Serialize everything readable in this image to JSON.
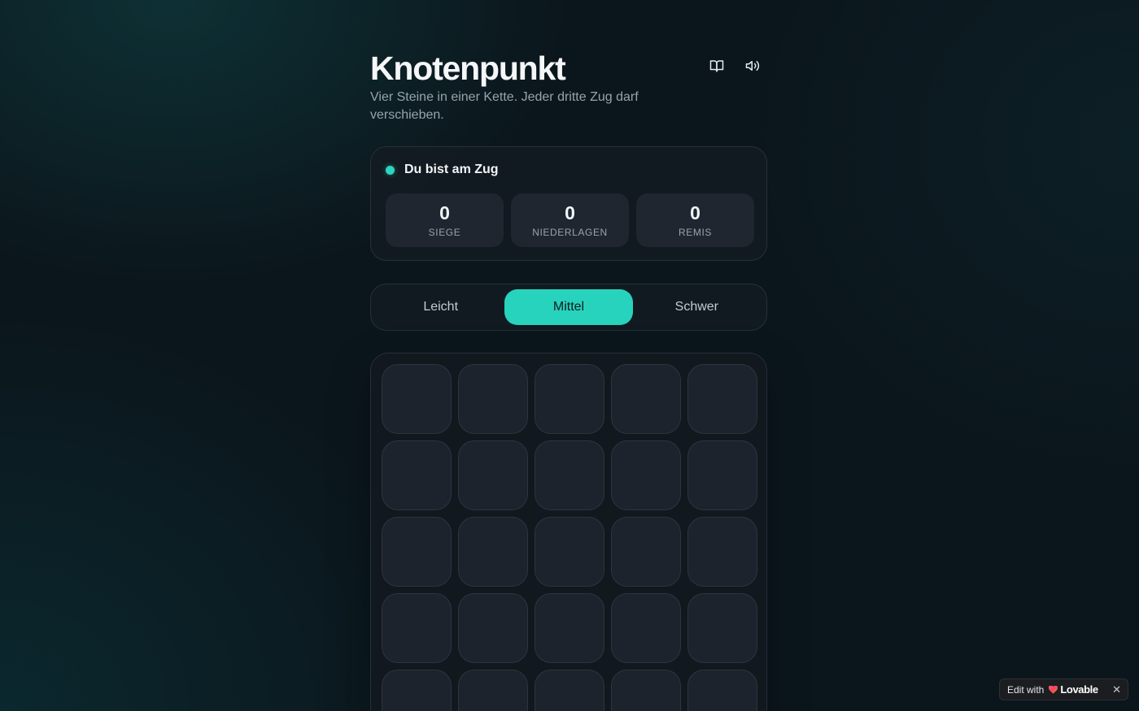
{
  "app": {
    "title": "Knotenpunkt",
    "subtitle": "Vier Steine in einer Kette. Jeder dritte Zug darf verschieben."
  },
  "toolbar": {
    "rules_icon": "book-open-icon",
    "sound_icon": "volume-icon"
  },
  "status": {
    "turn_text": "Du bist am Zug",
    "indicator_color": "#2dd4bf"
  },
  "stats": [
    {
      "value": "0",
      "label": "SIEGE"
    },
    {
      "value": "0",
      "label": "NIEDERLAGEN"
    },
    {
      "value": "0",
      "label": "REMIS"
    }
  ],
  "difficulty": {
    "options": [
      "Leicht",
      "Mittel",
      "Schwer"
    ],
    "selected": "Mittel",
    "accent_color": "#27d3bc"
  },
  "board": {
    "columns": 5,
    "visible_rows": 5,
    "cells": [
      [
        "",
        "",
        "",
        "",
        ""
      ],
      [
        "",
        "",
        "",
        "",
        ""
      ],
      [
        "",
        "",
        "",
        "",
        ""
      ],
      [
        "",
        "",
        "",
        "",
        ""
      ],
      [
        "",
        "",
        "",
        "",
        ""
      ]
    ]
  },
  "badge": {
    "edit_with": "Edit with",
    "brand": "Lovable",
    "close": "✕"
  }
}
